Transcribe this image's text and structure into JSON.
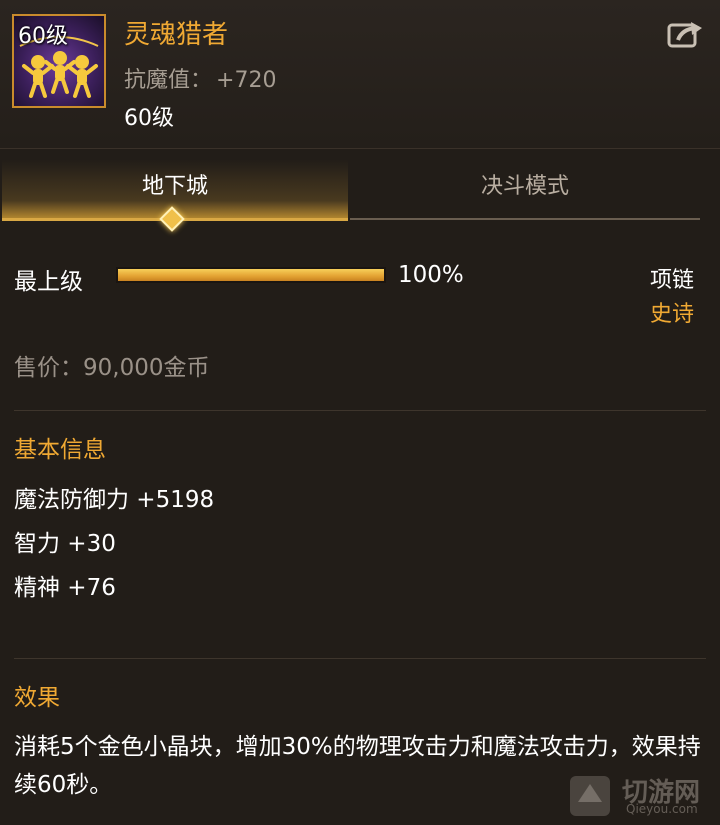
{
  "item": {
    "icon_level": "60级",
    "icon_name": "soul-hunter-item-icon",
    "name": "灵魂猎者",
    "stat_label": "抗魔值：",
    "stat_value": "+720",
    "level": "60级"
  },
  "tabs": [
    {
      "label": "地下城",
      "active": true
    },
    {
      "label": "决斗模式",
      "active": false
    }
  ],
  "rank": {
    "label": "最上级",
    "progress": 1.0,
    "percent_text": "100%"
  },
  "item_type": "项链",
  "rarity": "史诗",
  "price_text": "售价：90,000金币",
  "basic_info": {
    "title": "基本信息",
    "attrs": [
      "魔法防御力 +5198",
      "智力 +30",
      "精神 +76"
    ]
  },
  "effect": {
    "title": "效果",
    "text": "消耗5个金色小晶块，增加30%的物理攻击力和魔法攻击力，效果持续60秒。"
  },
  "watermark": {
    "text": "切游网",
    "sub": "Qieyou.com"
  },
  "colors": {
    "accent": "#f0a933",
    "background": "#221d18",
    "progress": "#e3a232"
  }
}
